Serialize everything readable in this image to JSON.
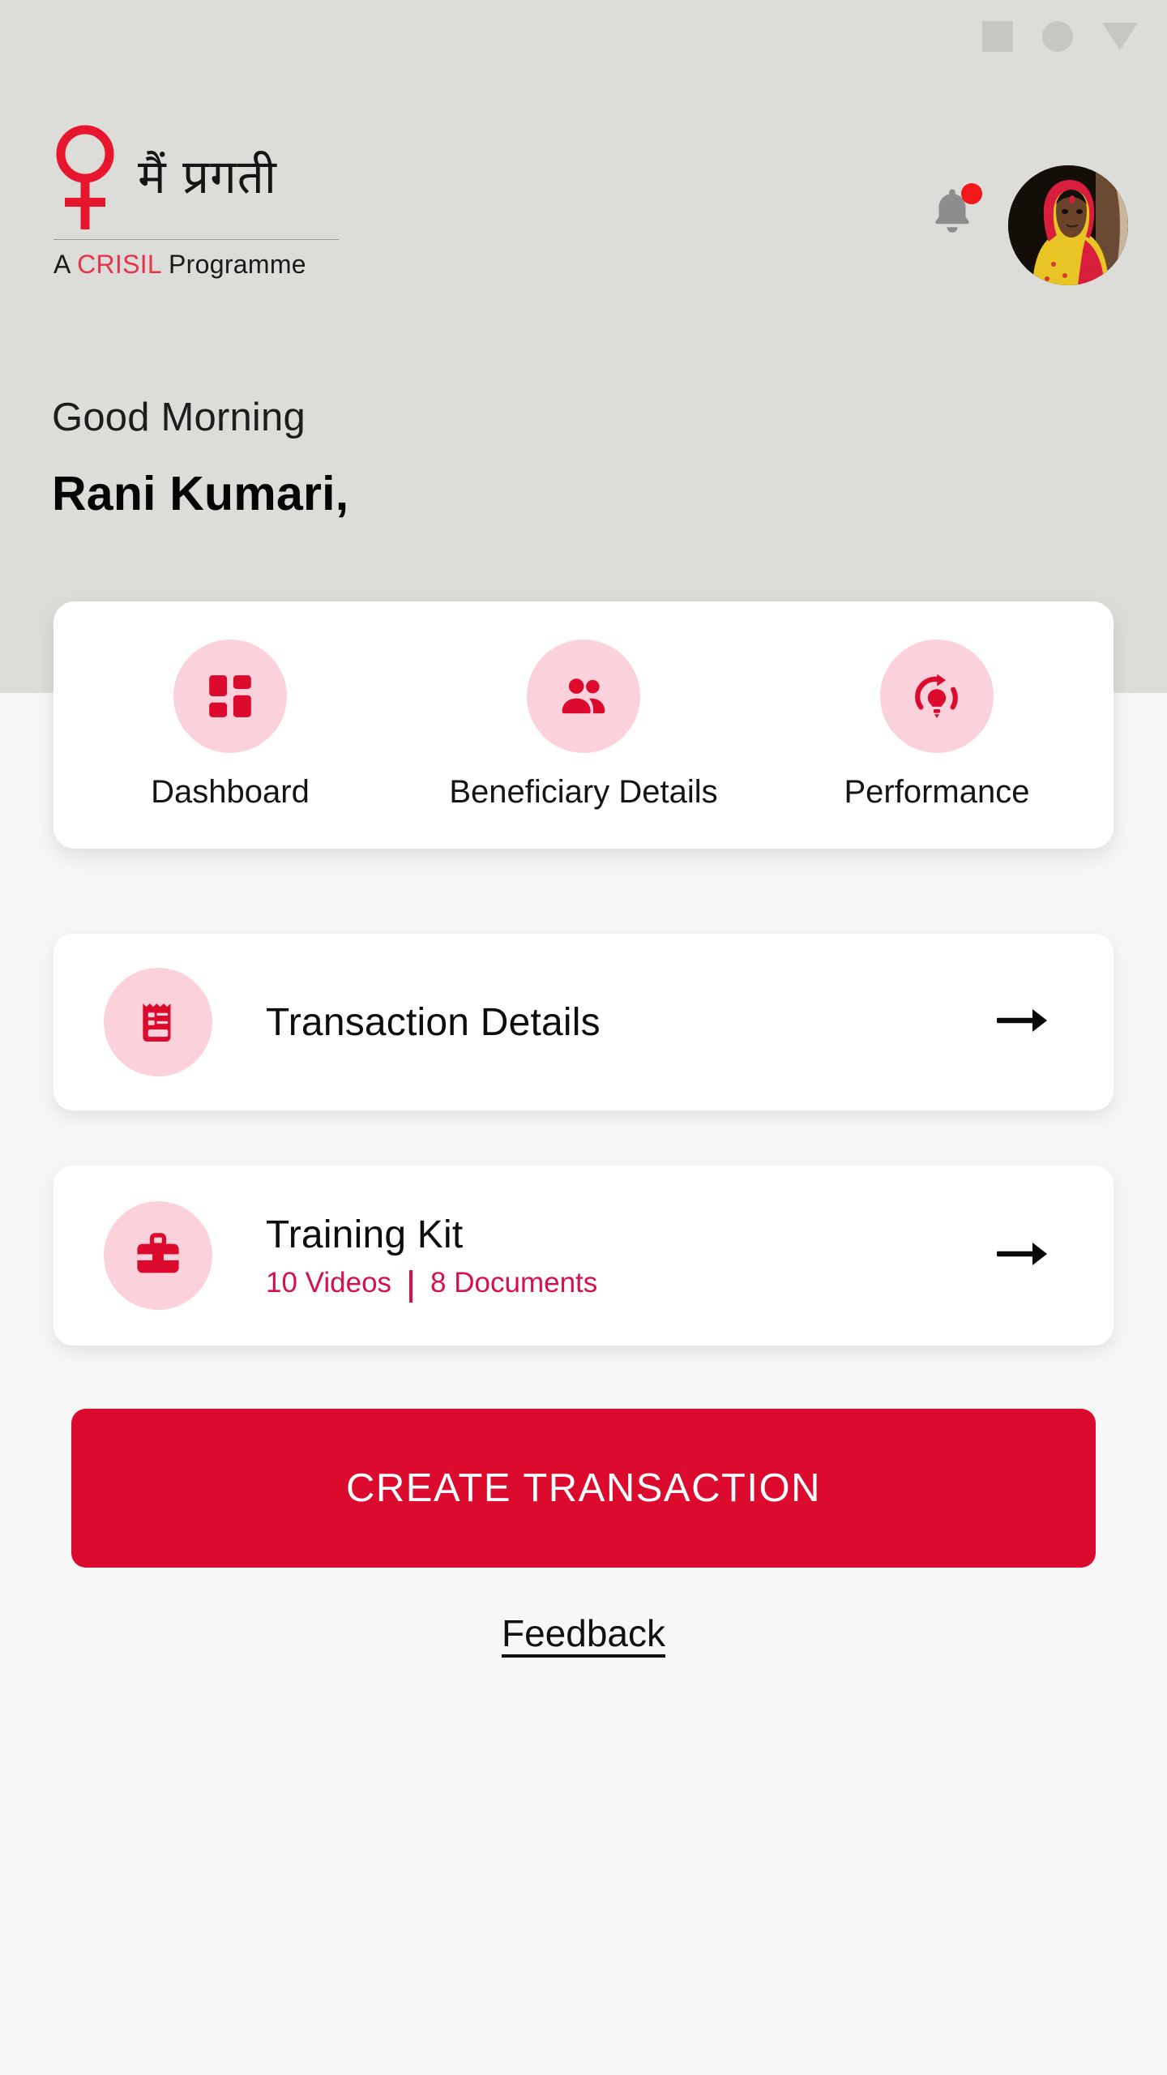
{
  "theme": {
    "brand_red": "#DC0A2D",
    "accent_pink": "#FBD2DB",
    "header_bg": "#DCDCD8",
    "page_bg": "#F7F7F7",
    "badge_red": "#F01818"
  },
  "statusbar": {
    "icons": [
      "square-placeholder-icon",
      "circle-placeholder-icon",
      "triangle-down-placeholder-icon"
    ]
  },
  "brand": {
    "logo_icon": "venus-symbol-icon",
    "title": "मैं प्रगती",
    "tagline_prefix": "A ",
    "tagline_brand": "CRISIL",
    "tagline_suffix": " Programme"
  },
  "header": {
    "bell_icon": "notification-bell-icon",
    "has_unread": true,
    "avatar_icon": "user-avatar-photo"
  },
  "greeting": {
    "salutation": "Good Morning",
    "name": "Rani Kumari,"
  },
  "quick_actions": [
    {
      "label": "Dashboard",
      "icon": "dashboard-grid-icon"
    },
    {
      "label": "Beneficiary Details",
      "icon": "people-group-icon"
    },
    {
      "label": "Performance",
      "icon": "performance-bulb-refresh-icon"
    }
  ],
  "rows": [
    {
      "title": "Transaction Details",
      "icon": "receipt-icon",
      "arrow_icon": "arrow-right-icon"
    },
    {
      "title": "Training Kit",
      "icon": "toolbox-briefcase-icon",
      "sub_videos": "10 Videos",
      "sub_documents": "8 Documents",
      "arrow_icon": "arrow-right-icon"
    }
  ],
  "cta": {
    "label": "CREATE TRANSACTION"
  },
  "feedback": {
    "label": "Feedback"
  }
}
